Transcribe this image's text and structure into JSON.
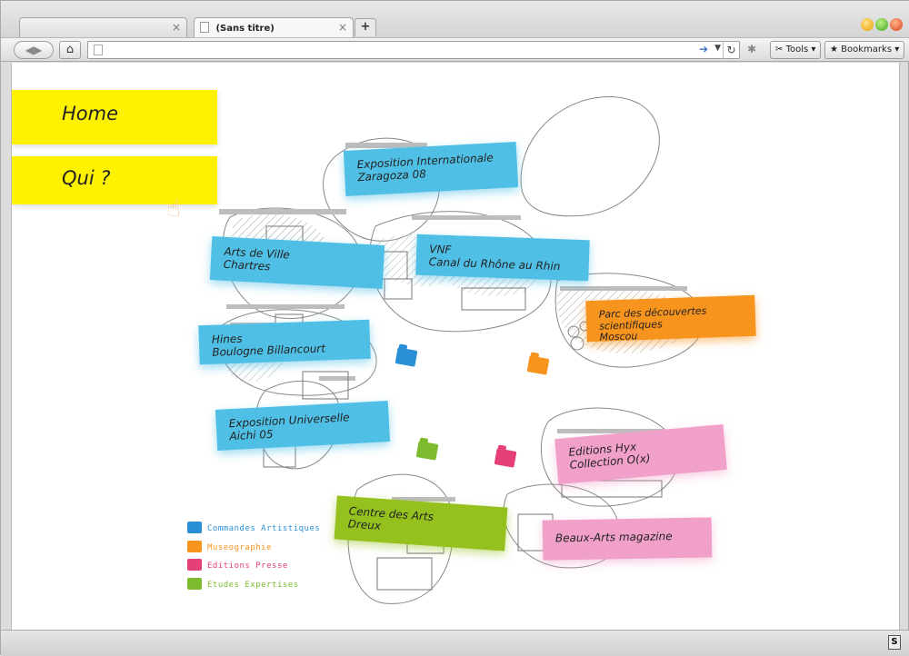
{
  "browser": {
    "tabs": [
      {
        "label": "",
        "active": false
      },
      {
        "label": "(Sans titre)",
        "active": true
      }
    ],
    "new_tab_label": "+",
    "tools_label": "Tools",
    "bookmarks_label": "Bookmarks",
    "url": ""
  },
  "nav": {
    "home_label": "Home",
    "qui_label": "Qui ?"
  },
  "notes": {
    "zaragoza": "Exposition Internationale\nZaragoza 08",
    "chartres": "Arts de Ville\nChartres",
    "vnf": "VNF\nCanal du Rhône au Rhin",
    "moscou": "Parc des découvertes scientifiques\nMoscou",
    "hines": "Hines\nBoulogne Billancourt",
    "aichi": "Exposition Universelle\nAichi 05",
    "hyx": "Editions Hyx\nCollection O(x)",
    "dreux": "Centre des Arts\nDreux",
    "beaux_arts": "Beaux-Arts magazine"
  },
  "legend": [
    {
      "label": "Commandes Artistiques",
      "color": "#2a8fd4"
    },
    {
      "label": "Museographie",
      "color": "#f7941d"
    },
    {
      "label": "Editions Presse",
      "color": "#e5407a"
    },
    {
      "label": "Etudes Expertises",
      "color": "#7dbb2e"
    }
  ],
  "colors": {
    "blue_note": "#50bfe5",
    "orange_note": "#f7941d",
    "pink_note": "#f1a0c9",
    "green_note": "#95c11f",
    "yellow_nav": "#fff200"
  },
  "status": {
    "icon": "S"
  }
}
